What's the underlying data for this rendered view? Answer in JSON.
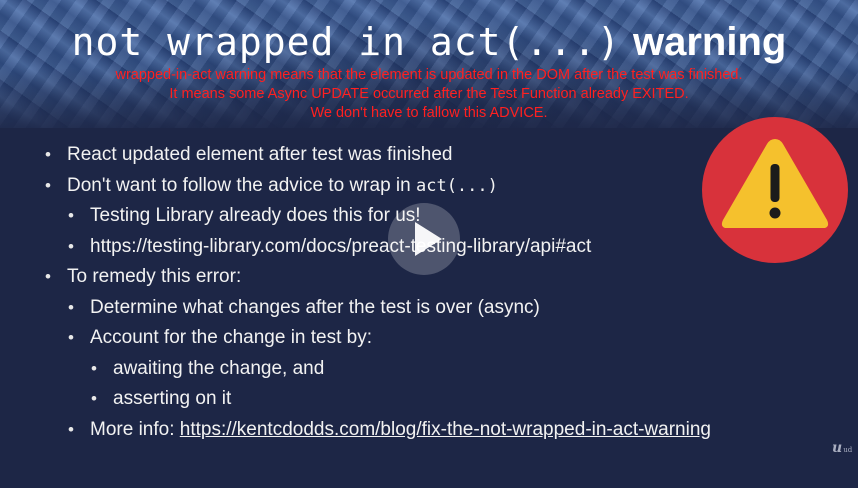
{
  "slide": {
    "title_code": "not wrapped in act(...)",
    "title_word": "warning",
    "annotation": [
      "wrapped-in-act warning means that the element is updated in the DOM after the test was finished.",
      "It means some Async UPDATE occurred after the Test Function already EXITED.",
      "We don't have to  fallow this ADVICE."
    ],
    "bullets": {
      "b1": "React updated element after test was finished",
      "b2_text": "Don't want to follow the advice to wrap in ",
      "b2_code": "act(...)",
      "b2a": "Testing Library already does this for us!",
      "b2b": "https://testing-library.com/docs/preact-testing-library/api#act",
      "b3": "To remedy this error:",
      "b3a": "Determine what changes after the test is over (async)",
      "b3b": "Account for the change in test by:",
      "b3b1": "awaiting the change, and",
      "b3b2": "asserting on it",
      "b3c_label": "More info: ",
      "b3c_link": "https://kentcdodds.com/blog/fix-the-not-wrapped-in-act-warning"
    }
  },
  "icons": {
    "warning": "warning-triangle-icon",
    "play": "play-icon"
  },
  "player": {
    "brand_mark": "u",
    "brand_suffix": "ud"
  },
  "colors": {
    "background": "#1d2646",
    "annotation": "#ff2020",
    "warning_circle": "#d8323b",
    "warning_triangle": "#f5c12d"
  }
}
